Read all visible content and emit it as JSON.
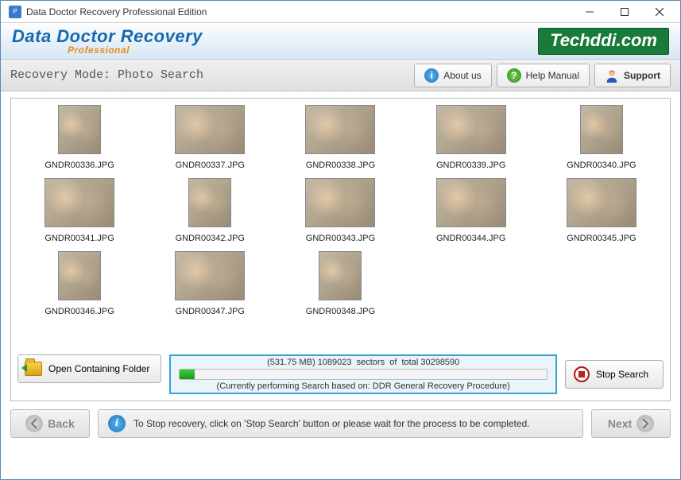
{
  "window": {
    "title": "Data Doctor Recovery Professional Edition"
  },
  "branding": {
    "product_line1": "Data Doctor Recovery",
    "product_line2": "Professional",
    "vendor_badge": "Techddi.com"
  },
  "toolbar": {
    "mode_label": "Recovery Mode: Photo Search",
    "about_label": "About us",
    "help_label": "Help Manual",
    "support_label": "Support"
  },
  "results": {
    "items": [
      {
        "filename": "GNDR00336.JPG",
        "orientation": "portrait"
      },
      {
        "filename": "GNDR00337.JPG",
        "orientation": "landscape"
      },
      {
        "filename": "GNDR00338.JPG",
        "orientation": "landscape"
      },
      {
        "filename": "GNDR00339.JPG",
        "orientation": "landscape"
      },
      {
        "filename": "GNDR00340.JPG",
        "orientation": "portrait"
      },
      {
        "filename": "GNDR00341.JPG",
        "orientation": "landscape"
      },
      {
        "filename": "GNDR00342.JPG",
        "orientation": "portrait"
      },
      {
        "filename": "GNDR00343.JPG",
        "orientation": "landscape"
      },
      {
        "filename": "GNDR00344.JPG",
        "orientation": "landscape"
      },
      {
        "filename": "GNDR00345.JPG",
        "orientation": "landscape"
      },
      {
        "filename": "GNDR00346.JPG",
        "orientation": "portrait"
      },
      {
        "filename": "GNDR00347.JPG",
        "orientation": "landscape"
      },
      {
        "filename": "GNDR00348.JPG",
        "orientation": "portrait"
      }
    ]
  },
  "actions": {
    "open_folder_label": "Open Containing Folder",
    "stop_search_label": "Stop Search"
  },
  "progress": {
    "size_recovered": "531.75 MB",
    "sectors_done": "1089023",
    "sectors_total": "30298590",
    "percent": 4,
    "procedure_label": "(Currently performing Search based on:  DDR General Recovery Procedure)"
  },
  "footer": {
    "back_label": "Back",
    "next_label": "Next",
    "info_text": "To Stop recovery, click on 'Stop Search' button or please wait for the process to be completed."
  }
}
